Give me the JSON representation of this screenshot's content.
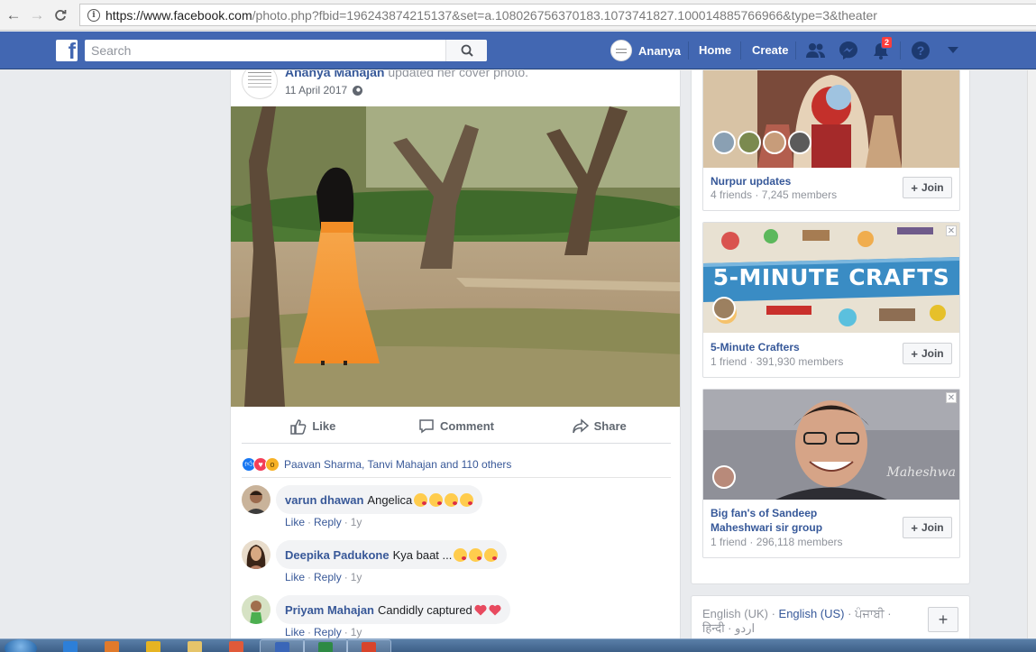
{
  "browser": {
    "url_domain": "https://www.facebook.com",
    "url_rest": "/photo.php?fbid=196243874215137&set=a.108026756370183.1073741827.100014885766966&type=3&theater"
  },
  "topbar": {
    "search_placeholder": "Search",
    "profile_name": "Ananya",
    "home_label": "Home",
    "create_label": "Create",
    "notifications_count": "2",
    "brand_color": "#4267b2"
  },
  "post": {
    "author": "Ananya Mahajan",
    "action": "updated her cover photo.",
    "date": "11 April 2017",
    "actions": {
      "like": "Like",
      "comment": "Comment",
      "share": "Share"
    },
    "reactions_text": "Paavan Sharma, Tanvi Mahajan and 110 others",
    "comments": [
      {
        "name": "varun dhawan",
        "text": "Angelica",
        "like": "Like",
        "reply": "Reply",
        "time": "1y"
      },
      {
        "name": "Deepika Padukone",
        "text": "Kya baat ...",
        "like": "Like",
        "reply": "Reply",
        "time": "1y"
      },
      {
        "name": "Priyam Mahajan",
        "text": "Candidly captured",
        "like": "Like",
        "reply": "Reply",
        "time": "1y"
      }
    ]
  },
  "groups": [
    {
      "name": "Nurpur updates",
      "meta": "4 friends · 7,245 members",
      "join": "Join"
    },
    {
      "name": "5-Minute Crafters",
      "meta": "1 friend · 391,930 members",
      "join": "Join",
      "banner": "5-MINUTE CRAFTS"
    },
    {
      "name": "Big fan's of Sandeep Maheshwari sir group",
      "meta": "1 friend · 296,118 members",
      "join": "Join",
      "watermark": "Maheshwa"
    }
  ],
  "languages": {
    "first": "English (UK)",
    "current": "English (US)",
    "punjabi": "ਪੰਜਾਬੀ",
    "hindi": "हिन्दी",
    "urdu": "اردو"
  }
}
